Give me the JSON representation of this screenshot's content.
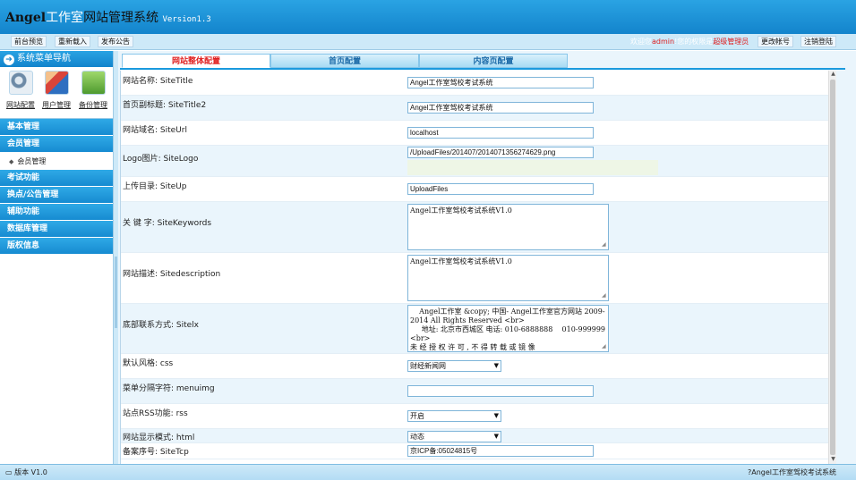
{
  "header": {
    "logo_a": "Angel",
    "logo_b": "工作室",
    "logo_c": "网站管理系统",
    "version": "Version1.3"
  },
  "toolbar": {
    "buttons": [
      "前台预览",
      "重新载入",
      "发布公告"
    ],
    "welcome_prefix": "欢迎您",
    "username": "admin",
    "welcome_mid": "!您的权限是",
    "role": "超级管理员",
    "change_account": "更改帐号",
    "logout": "注销登陆"
  },
  "sidebar": {
    "title": "系统菜单导航",
    "quick": [
      {
        "label": "网站配置",
        "icon": "gears-icon"
      },
      {
        "label": "用户管理",
        "icon": "users-icon"
      },
      {
        "label": "备份管理",
        "icon": "backup-icon"
      }
    ],
    "menu": [
      {
        "label": "基本管理"
      },
      {
        "label": "会员管理"
      },
      {
        "label": "会员管理",
        "sub": true
      },
      {
        "label": "考试功能"
      },
      {
        "label": "换点/公告管理"
      },
      {
        "label": "辅助功能"
      },
      {
        "label": "数据库管理"
      },
      {
        "label": "版权信息"
      }
    ]
  },
  "tabs": [
    "网站整体配置",
    "首页配置",
    "内容页配置"
  ],
  "form": {
    "site_title": {
      "label": "网站名称: SiteTitle",
      "value": "Angel工作室驾校考试系统"
    },
    "site_title2": {
      "label": "首页副标题: SiteTitle2",
      "value": "Angel工作室驾校考试系统"
    },
    "site_url": {
      "label": "网站域名: SiteUrl",
      "value": "localhost"
    },
    "site_logo": {
      "label": "Logo图片: SiteLogo",
      "value": "/UploadFiles/201407/2014071356274629.png"
    },
    "site_up": {
      "label": "上传目录: SiteUp",
      "value": "UploadFiles"
    },
    "site_keywords": {
      "label": "关 键 字: SiteKeywords",
      "value": "Angel工作室驾校考试系统V1.0"
    },
    "site_description": {
      "label": "网站描述: Sitedescription",
      "value": "Angel工作室驾校考试系统V1.0"
    },
    "site_lx": {
      "label": "底部联系方式: Sitelx",
      "value": "    Angel工作室 &copy; 中国- Angel工作室官方网站 2009-2014 All Rights Reserved <br>\n     地址: 北京市西城区 电话: 010-6888888    010-999999  <br>\n未 经 授 权 许 可 , 不 得 转 载 或 镜 像"
    },
    "css": {
      "label": "默认风格: css",
      "value": "财经新闻网"
    },
    "menuimg": {
      "label": "菜单分隔字符: menuimg",
      "value": ""
    },
    "rss": {
      "label": "站点RSS功能: rss",
      "value": "开启"
    },
    "html": {
      "label": "网站显示模式: html",
      "value": "动态"
    },
    "site_tcp": {
      "label": "备案序号: SiteTcp",
      "value": "京ICP备:05024815号"
    }
  },
  "footer": {
    "version": "版本 V1.0",
    "system": "Angel工作室驾校考试系统"
  }
}
